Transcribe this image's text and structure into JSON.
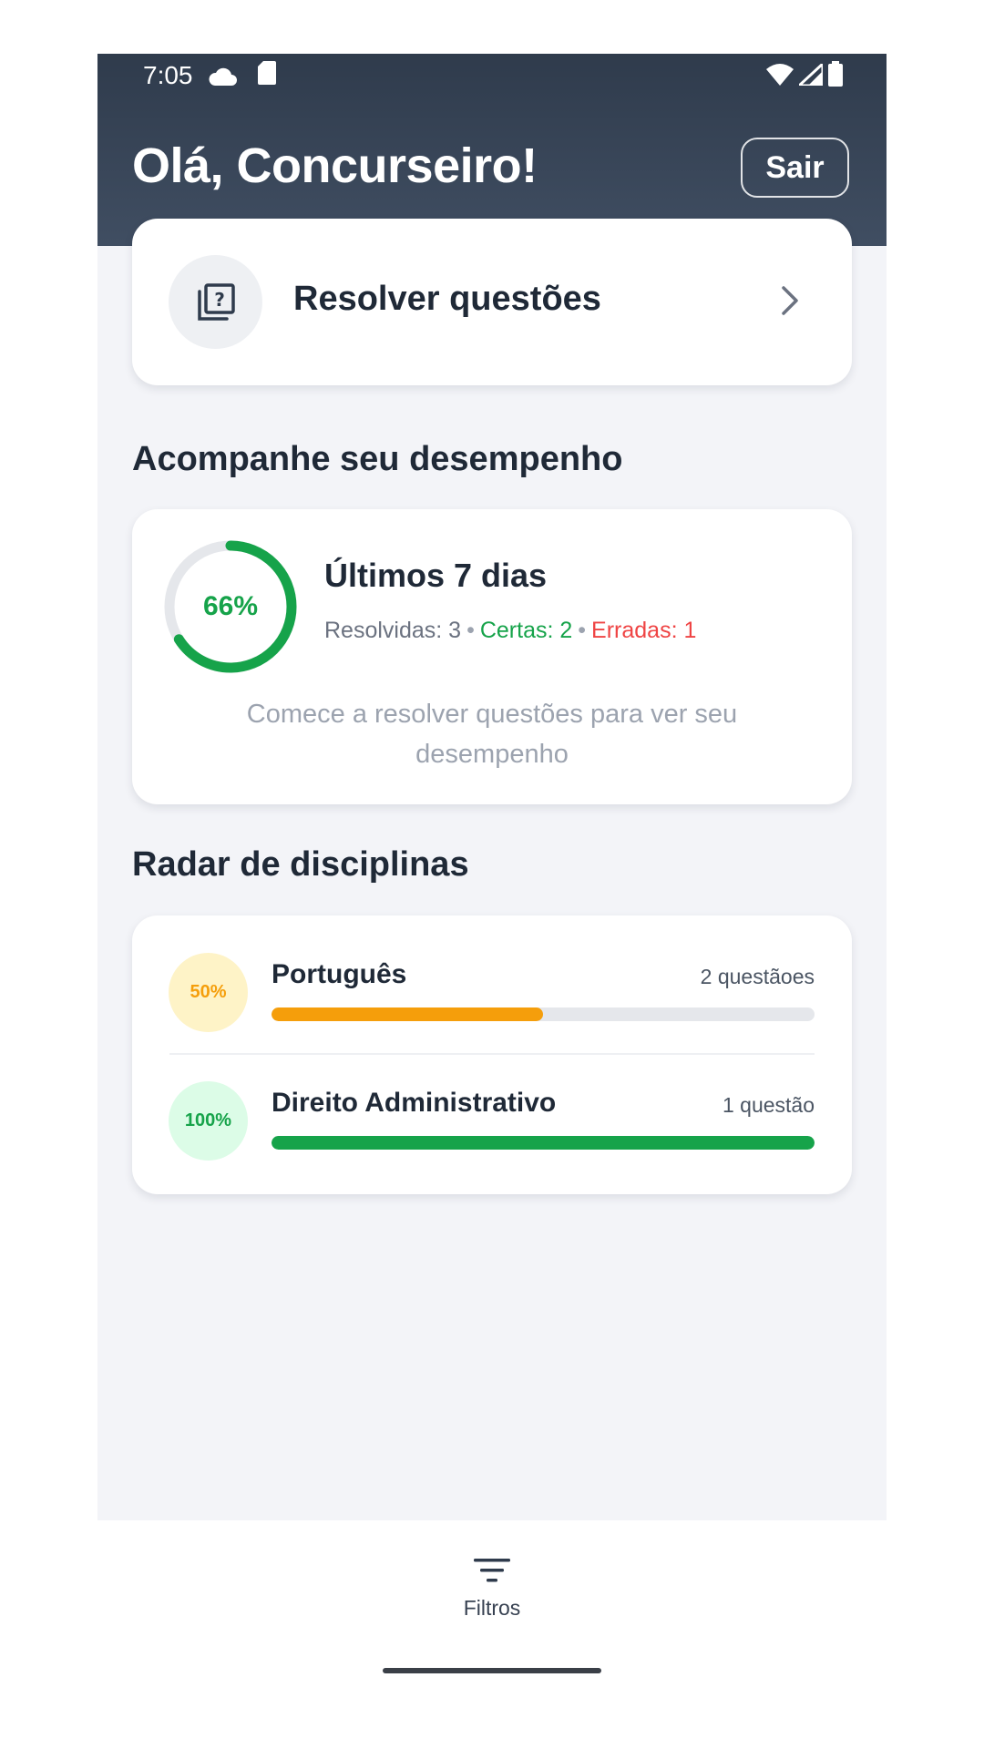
{
  "status_bar": {
    "time": "7:05",
    "icons": [
      "cloud-icon",
      "sd-card-icon",
      "wifi-icon",
      "signal-icon",
      "battery-icon"
    ]
  },
  "header": {
    "greeting": "Olá, Concurseiro!",
    "logout_label": "Sair"
  },
  "solve_card": {
    "label": "Resolver questões",
    "icon": "question-stack-icon"
  },
  "performance": {
    "section_title": "Acompanhe seu desempenho",
    "percent_label": "66%",
    "percent_value": 0.66,
    "period_title": "Últimos 7 dias",
    "resolved_label": "Resolvidas: 3",
    "correct_label": "Certas: 2",
    "wrong_label": "Erradas: 1",
    "separator": "•",
    "empty_note": "Comece a resolver questões para ver seu desempenho"
  },
  "radar": {
    "section_title": "Radar de disciplinas",
    "subjects": [
      {
        "name": "Português",
        "percent_label": "50%",
        "progress": 0.5,
        "count_label": "2 questãoes",
        "color": "#f59e0b",
        "bg": "#fef3c7"
      },
      {
        "name": "Direito Administrativo",
        "percent_label": "100%",
        "progress": 1.0,
        "count_label": "1 questão",
        "color": "#16a34a",
        "bg": "#dcfce7"
      }
    ]
  },
  "bottom_nav": {
    "filter_label": "Filtros"
  },
  "colors": {
    "header_bg": "#354256",
    "accent_green": "#16a34a",
    "accent_red": "#ef4444",
    "accent_orange": "#f59e0b"
  }
}
